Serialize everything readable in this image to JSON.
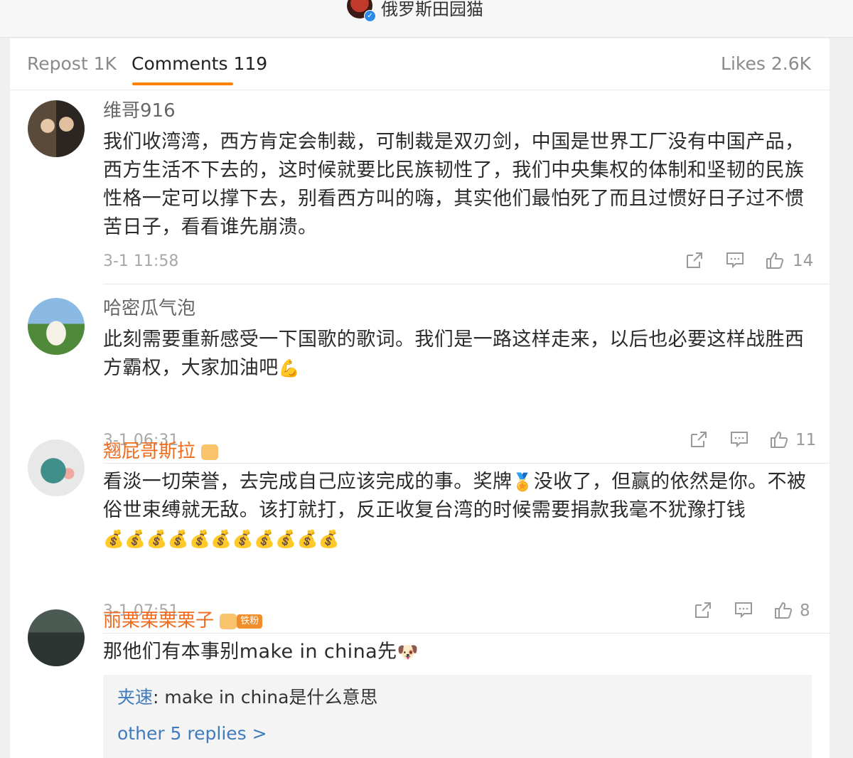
{
  "header": {
    "username": "俄罗斯田园猫"
  },
  "tabs": {
    "repost": "Repost 1K",
    "comments": "Comments 119",
    "likes": "Likes 2.6K"
  },
  "comments": [
    {
      "author": "维哥916",
      "text": "我们收湾湾，西方肯定会制裁，可制裁是双刃剑，中国是世界工厂没有中国产品，西方生活不下去的，这时候就要比民族韧性了，我们中央集权的体制和坚韧的民族性格一定可以撑下去，别看西方叫的嗨，其实他们最怕死了而且过惯好日子过不惯苦日子，看看谁先崩溃。",
      "time": "3-1 11:58",
      "likes": "14"
    },
    {
      "author": "哈密瓜气泡",
      "text": "此刻需要重新感受一下国歌的歌词。我们是一路这样走来，以后也必要这样战胜西方霸权，大家加油吧",
      "emoji": "💪",
      "time": "3-1 06:31",
      "likes": "11"
    },
    {
      "author": "翘屁哥斯拉",
      "text_part1": "看淡一切荣誉，去完成自己应该完成的事。奖牌",
      "medal_emoji": "🏅",
      "text_part2": "没收了，但赢的依然是你。不被俗世束缚就无敌。该打就打，反正收复台湾的时候需要捐款我毫不犹豫打钱",
      "money_emoji": "💰💰💰💰💰💰💰💰💰💰💰",
      "time": "3-1 07:51",
      "likes": "8"
    },
    {
      "author": "丽栗栗栗栗子",
      "fan_badge": "铁粉",
      "text": "那他们有本事别make in china先",
      "emoji": "🐶",
      "reply": {
        "author": "夹速",
        "text": ": make in china是什么意思"
      },
      "more_replies": "other 5 replies >"
    }
  ],
  "colors": {
    "accent": "#ff8200",
    "link": "#3f7bbd",
    "vip_name": "#f26b1d"
  }
}
